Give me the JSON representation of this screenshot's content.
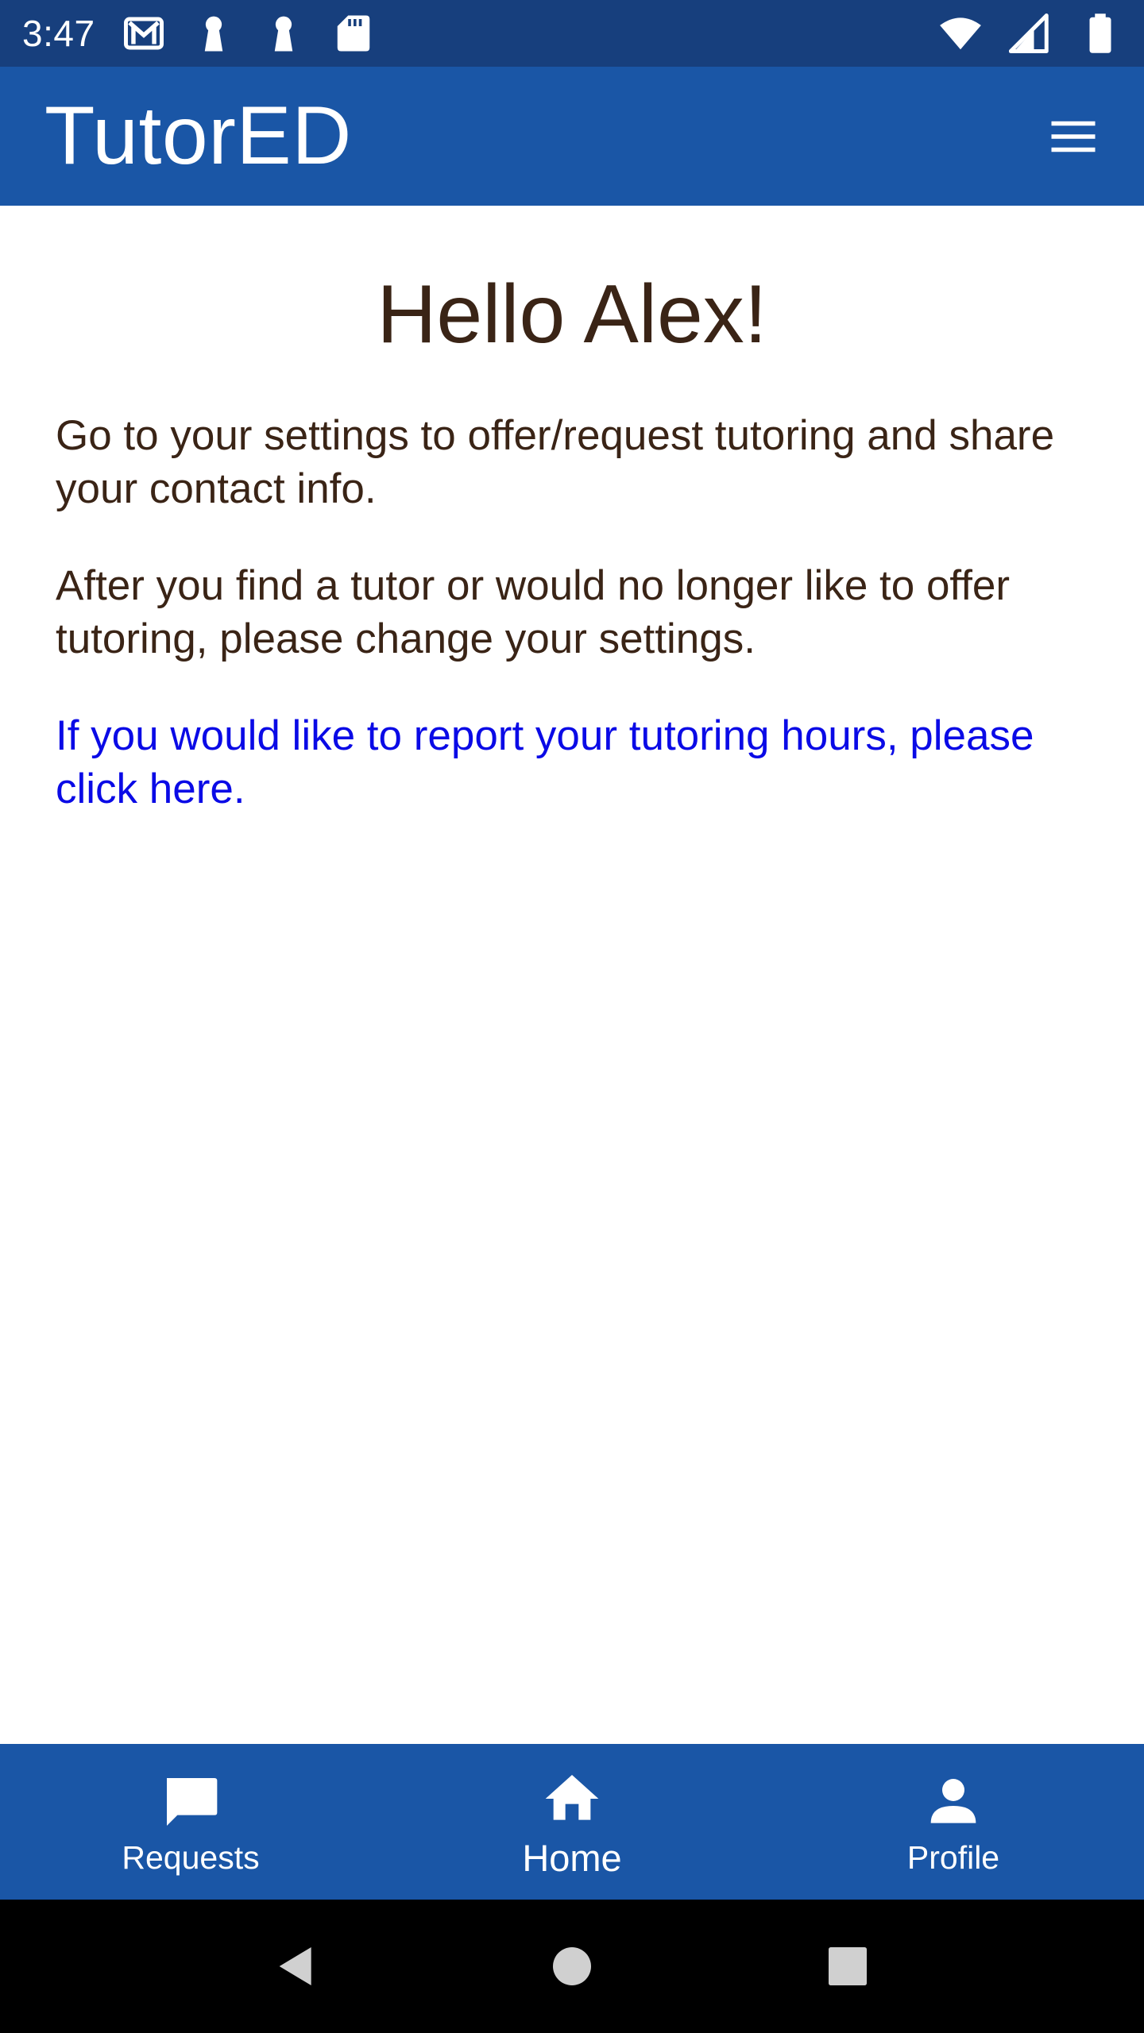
{
  "status_bar": {
    "time": "3:47",
    "left_icons": [
      "gmail-icon",
      "keyhole-icon",
      "keyhole-icon",
      "sd-card-icon"
    ],
    "right_icons": [
      "wifi-icon",
      "signal-icon",
      "battery-icon"
    ]
  },
  "app_bar": {
    "title": "TutorED",
    "menu_icon": "hamburger-menu-icon"
  },
  "main": {
    "greeting": "Hello Alex!",
    "paragraph_1": "Go to your settings to offer/request tutoring and share your contact info.",
    "paragraph_2": "After you find a tutor or would no longer like to offer tutoring, please change your settings.",
    "report_link": "If you would like to report your tutoring hours, please click here."
  },
  "bottom_nav": {
    "items": [
      {
        "label": "Requests",
        "icon": "chat-bubble-icon"
      },
      {
        "label": "Home",
        "icon": "home-icon"
      },
      {
        "label": "Profile",
        "icon": "person-icon"
      }
    ],
    "active": "Home"
  },
  "system_nav": {
    "buttons": [
      "back-icon",
      "home-circle-icon",
      "recents-square-icon"
    ]
  },
  "colors": {
    "status_bar": "#173f7d",
    "primary": "#1a56a6",
    "text": "#3a2416",
    "link": "#0a0ae6"
  }
}
